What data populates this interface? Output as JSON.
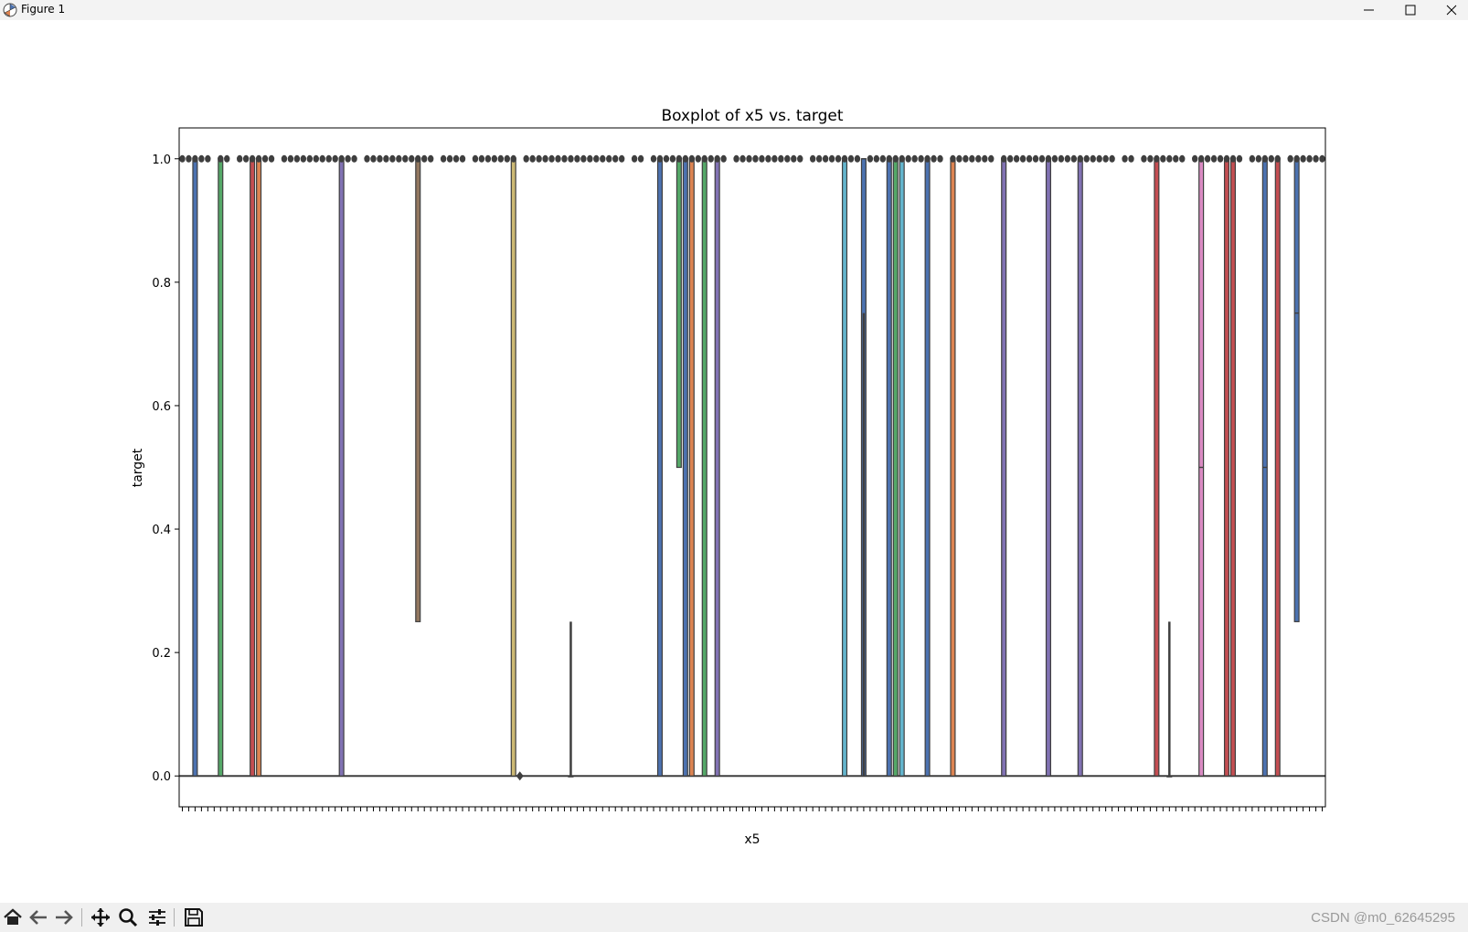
{
  "window": {
    "title": "Figure 1"
  },
  "watermark": "CSDN @m0_62645295",
  "toolbar": {
    "buttons": [
      "home-icon",
      "back-icon",
      "forward-icon",
      "pan-icon",
      "zoom-icon",
      "configure-icon",
      "save-icon"
    ]
  },
  "chart_data": {
    "type": "boxplot",
    "title": "Boxplot of x5 vs. target",
    "xlabel": "x5",
    "ylabel": "target",
    "ylim": [
      -0.05,
      1.05
    ],
    "yticks": [
      0.0,
      0.2,
      0.4,
      0.6,
      0.8,
      1.0
    ],
    "ytick_labels": [
      "0.0",
      "0.2",
      "0.4",
      "0.6",
      "0.8",
      "1.0"
    ],
    "category_count": 180,
    "grid": false,
    "legend": "none",
    "notable_boxes": [
      {
        "index": 2,
        "q1": 0,
        "median": 1,
        "q3": 1,
        "color": "#4c72b0"
      },
      {
        "index": 6,
        "q1": 0,
        "median": 1,
        "q3": 1,
        "color": "#55a868"
      },
      {
        "index": 11,
        "q1": 0,
        "median": 1,
        "q3": 1,
        "color": "#c44e52"
      },
      {
        "index": 12,
        "q1": 0,
        "median": 1,
        "q3": 1,
        "color": "#dd8452"
      },
      {
        "index": 25,
        "q1": 0,
        "median": 1,
        "q3": 1,
        "color": "#8172b3"
      },
      {
        "index": 37,
        "q1": 0.25,
        "median": 1,
        "q3": 1,
        "whisker_low": 0.25,
        "color": "#937860"
      },
      {
        "index": 52,
        "q1": 0,
        "median": 1,
        "q3": 1,
        "color": "#ccb974"
      },
      {
        "index": 61,
        "q1": 0,
        "median": 0,
        "q3": 0,
        "whisker_high": 0.25,
        "color": "#64b5cd"
      },
      {
        "index": 75,
        "q1": 0,
        "median": 1,
        "q3": 1,
        "color": "#4c72b0"
      },
      {
        "index": 78,
        "q1": 0.5,
        "median": 1,
        "q3": 1,
        "color": "#55a868"
      },
      {
        "index": 79,
        "q1": 0,
        "median": 1,
        "q3": 1,
        "color": "#4c72b0"
      },
      {
        "index": 80,
        "q1": 0,
        "median": 1,
        "q3": 1,
        "color": "#dd8452"
      },
      {
        "index": 82,
        "q1": 0,
        "median": 1,
        "q3": 1,
        "color": "#55a868"
      },
      {
        "index": 84,
        "q1": 0,
        "median": 1,
        "q3": 1,
        "color": "#8172b3"
      },
      {
        "index": 104,
        "q1": 0,
        "median": 1,
        "q3": 1,
        "color": "#64b5cd"
      },
      {
        "index": 107,
        "q1": 0,
        "median": 1,
        "q3": 1,
        "whisker_low": 0.75,
        "color": "#4c72b0"
      },
      {
        "index": 111,
        "q1": 0,
        "median": 1,
        "q3": 1,
        "color": "#4c72b0"
      },
      {
        "index": 112,
        "q1": 0,
        "median": 1,
        "q3": 1,
        "color": "#55a868"
      },
      {
        "index": 113,
        "q1": 0,
        "median": 1,
        "q3": 1,
        "color": "#64b5cd"
      },
      {
        "index": 117,
        "q1": 0,
        "median": 1,
        "q3": 1,
        "color": "#4c72b0"
      },
      {
        "index": 121,
        "q1": 0,
        "median": 1,
        "q3": 1,
        "color": "#dd8452"
      },
      {
        "index": 129,
        "q1": 0,
        "median": 1,
        "q3": 1,
        "color": "#8172b3"
      },
      {
        "index": 136,
        "q1": 0,
        "median": 1,
        "q3": 1,
        "color": "#8172b3"
      },
      {
        "index": 141,
        "q1": 0,
        "median": 1,
        "q3": 1,
        "color": "#8172b3"
      },
      {
        "index": 153,
        "q1": 0,
        "median": 1,
        "q3": 1,
        "color": "#c44e52"
      },
      {
        "index": 155,
        "q1": 0,
        "median": 0,
        "q3": 0,
        "whisker_high": 0.25,
        "color": "#4c72b0"
      },
      {
        "index": 160,
        "q1": 0,
        "median": 0.5,
        "q3": 1,
        "color": "#da8bc3"
      },
      {
        "index": 164,
        "q1": 0,
        "median": 1,
        "q3": 1,
        "color": "#c44e52"
      },
      {
        "index": 165,
        "q1": 0,
        "median": 1,
        "q3": 1,
        "color": "#c44e52"
      },
      {
        "index": 170,
        "q1": 0,
        "median": 0.5,
        "q3": 1,
        "color": "#4c72b0"
      },
      {
        "index": 172,
        "q1": 0,
        "median": 1,
        "q3": 1,
        "color": "#c44e52"
      },
      {
        "index": 175,
        "q1": 0.25,
        "median": 0.75,
        "q3": 1,
        "color": "#4c72b0"
      }
    ],
    "outliers_at_one_sampled": true,
    "note_outliers": [
      0,
      1
    ]
  }
}
